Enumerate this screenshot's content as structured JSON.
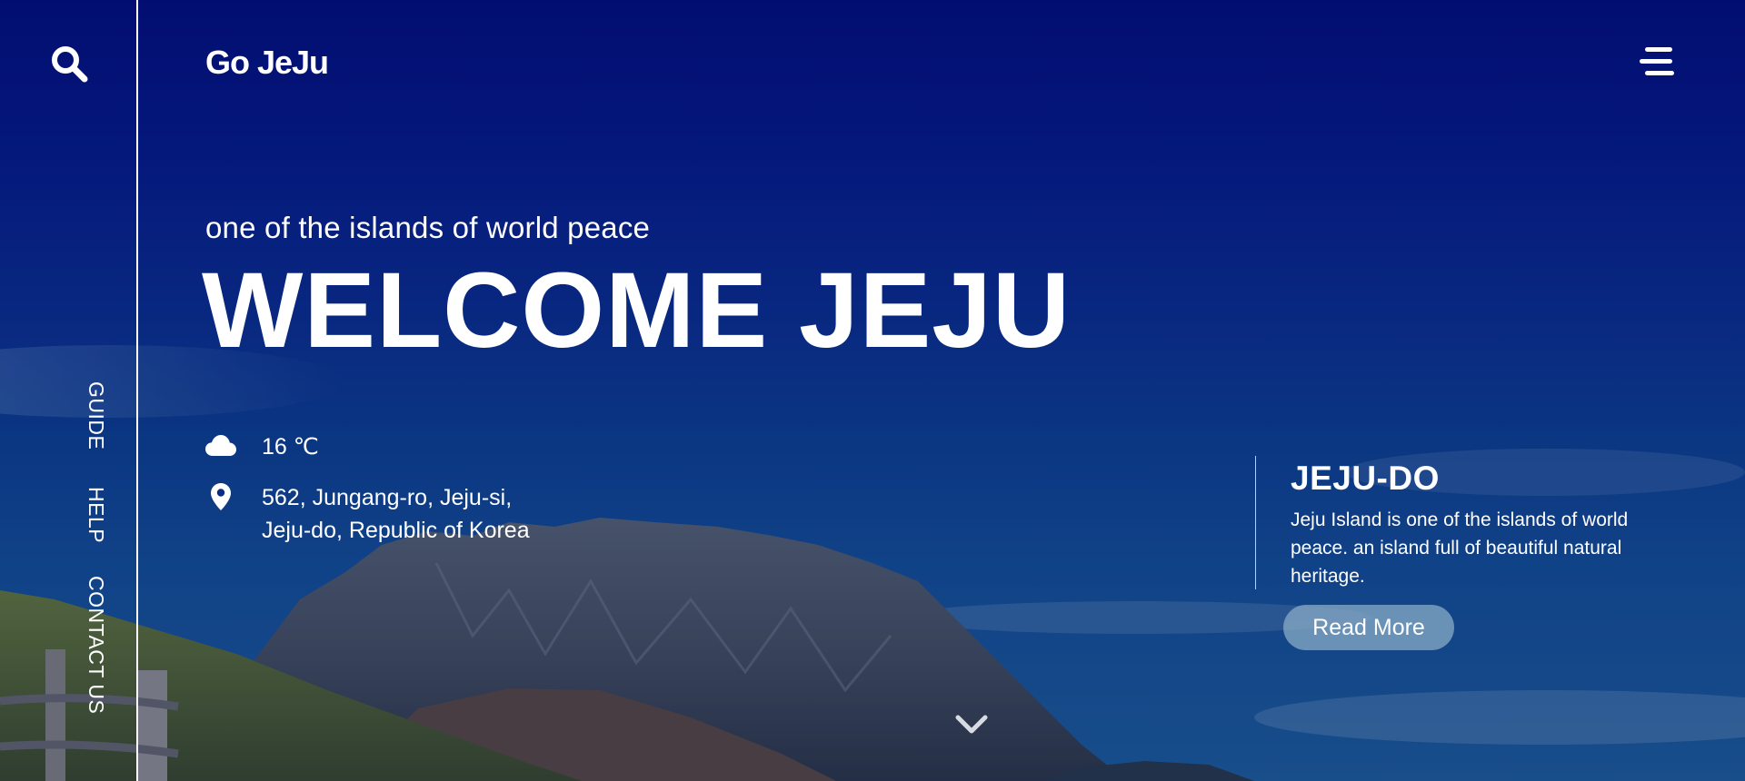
{
  "header": {
    "logo": "Go JeJu"
  },
  "sidebar": {
    "links": [
      "GUIDE",
      "HELP",
      "CONTACT US"
    ]
  },
  "hero": {
    "tagline": "one of the islands of world peace",
    "title": "WELCOME JEJU",
    "weather": "16 ℃",
    "address_line1": "562, Jungang-ro, Jeju-si,",
    "address_line2": "Jeju-do, Republic of Korea"
  },
  "card": {
    "title": "JEJU-DO",
    "description": "Jeju Island is one of the islands of world peace. an island full of beautiful natural heritage.",
    "button": "Read More"
  },
  "icons": {
    "search": "search-icon",
    "menu": "menu-icon",
    "weather": "cloud-icon",
    "location": "location-pin-icon",
    "scroll": "chevron-down-icon"
  },
  "colors": {
    "sky_top": "#020a72",
    "sky_bottom": "#1f6093",
    "button_bg": "#8cafc8",
    "text": "#ffffff"
  }
}
